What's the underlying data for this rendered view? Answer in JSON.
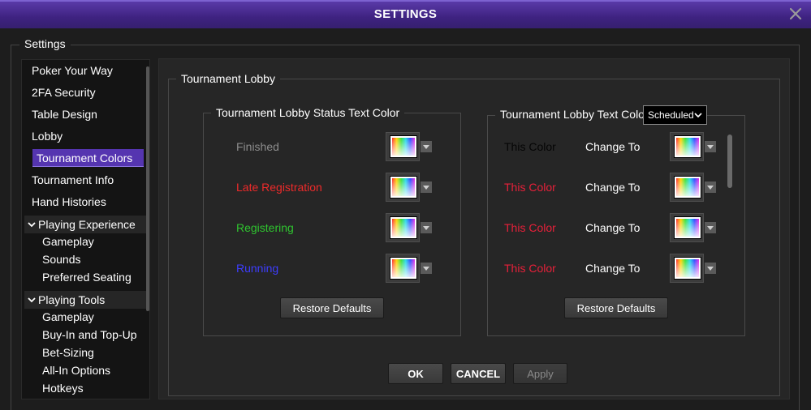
{
  "window": {
    "title": "SETTINGS"
  },
  "outer_group": {
    "label": "Settings"
  },
  "sidebar": {
    "items": [
      {
        "label": "Poker Your Way"
      },
      {
        "label": "2FA Security"
      },
      {
        "label": "Table Design"
      },
      {
        "label": "Lobby"
      },
      {
        "label": "Tournament Colors",
        "selected": true
      },
      {
        "label": "Tournament Info"
      },
      {
        "label": "Hand Histories"
      }
    ],
    "groups": [
      {
        "label": "Playing Experience",
        "expanded": true,
        "children": [
          "Gameplay",
          "Sounds",
          "Preferred Seating"
        ]
      },
      {
        "label": "Playing Tools",
        "expanded": true,
        "children": [
          "Gameplay",
          "Buy-In and Top-Up",
          "Bet-Sizing",
          "All-In Options",
          "Hotkeys"
        ]
      }
    ]
  },
  "main": {
    "group_label": "Tournament Lobby",
    "status_panel": {
      "label": "Tournament Lobby Status Text Color",
      "rows": [
        {
          "label": "Finished",
          "color": "#8c8c8c"
        },
        {
          "label": "Late Registration",
          "color": "#ee2a2a"
        },
        {
          "label": "Registering",
          "color": "#2fc42f"
        },
        {
          "label": "Running",
          "color": "#3d3dff"
        }
      ],
      "restore_label": "Restore Defaults"
    },
    "text_panel": {
      "label": "Tournament Lobby Text Colors",
      "dropdown_value": "Scheduled",
      "rows": [
        {
          "this_color": "This Color",
          "this_color_hex": "#050505",
          "change_to": "Change To"
        },
        {
          "this_color": "This Color",
          "this_color_hex": "#e8203a",
          "change_to": "Change To"
        },
        {
          "this_color": "This Color",
          "this_color_hex": "#e8203a",
          "change_to": "Change To"
        },
        {
          "this_color": "This Color",
          "this_color_hex": "#e8203a",
          "change_to": "Change To"
        }
      ],
      "restore_label": "Restore Defaults"
    },
    "buttons": {
      "ok": "OK",
      "cancel": "CANCEL",
      "apply": "Apply"
    }
  },
  "colors": {
    "titlebar": "#3e2280",
    "selection": "#5535b0",
    "background": "#1d1d1d",
    "panel": "#262626"
  },
  "icons": {
    "close": "close-icon",
    "expand": "chevron-down-icon",
    "swatch_dropdown": "triangle-down-icon"
  }
}
